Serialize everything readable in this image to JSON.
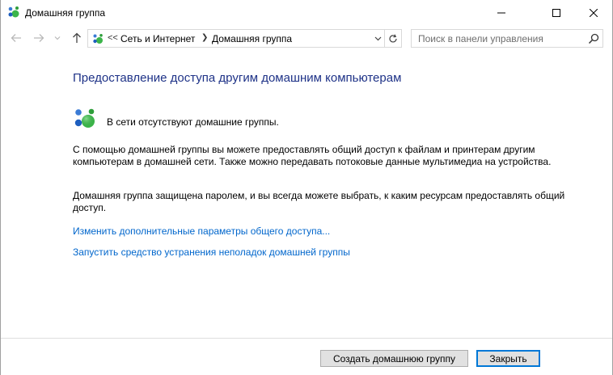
{
  "window": {
    "title": "Домашняя группа"
  },
  "address_bar": {
    "overflow_chevron": "<<",
    "breadcrumbs": [
      "Сеть и Интернет",
      "Домашняя группа"
    ]
  },
  "search": {
    "placeholder": "Поиск в панели управления"
  },
  "content": {
    "heading": "Предоставление доступа другим домашним компьютерам",
    "status": "В сети отсутствуют домашние группы.",
    "paragraph1": "С помощью домашней группы вы можете предоставлять общий доступ к файлам и принтерам другим компьютерам в домашней сети. Также можно передавать потоковые данные мультимедиа на устройства.",
    "paragraph2": "Домашняя группа защищена паролем, и вы всегда можете выбрать, к каким ресурсам предоставлять общий доступ.",
    "link_advanced": "Изменить дополнительные параметры общего доступа...",
    "link_troubleshoot": "Запустить средство устранения неполадок домашней группы"
  },
  "buttons": {
    "create": "Создать домашнюю группу",
    "close": "Закрыть"
  },
  "colors": {
    "heading": "#1e3287",
    "link": "#0066cc",
    "accent": "#0078d7"
  },
  "icons": {
    "app": "homegroup-icon",
    "search": "search-icon"
  }
}
